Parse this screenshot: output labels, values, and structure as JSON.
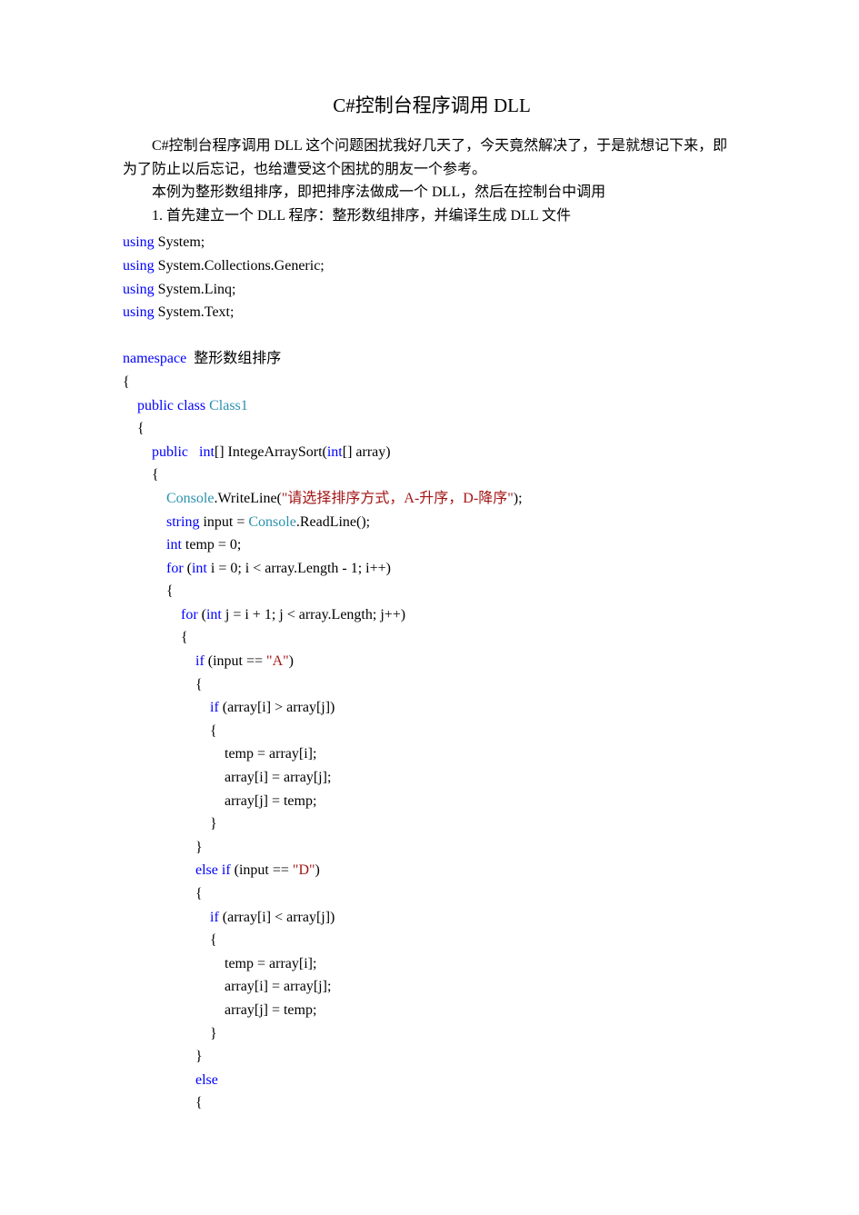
{
  "title": "C#控制台程序调用 DLL",
  "para1": "C#控制台程序调用 DLL 这个问题困扰我好几天了，今天竟然解决了，于是就想记下来，即为了防止以后忘记，也给遭受这个困扰的朋友一个参考。",
  "para2": "本例为整形数组排序，即把排序法做成一个 DLL，然后在控制台中调用",
  "para3": "1.  首先建立一个 DLL 程序：整形数组排序，并编译生成 DLL 文件",
  "code": {
    "kw_using": "using",
    "ns_system": " System;",
    "ns_generic": " System.Collections.Generic;",
    "ns_linq": " System.Linq;",
    "ns_text": " System.Text;",
    "kw_namespace": "namespace",
    "nsname": "  整形数组排序",
    "lb": "{",
    "rb": "}",
    "kw_public": "public",
    "kw_class": " class ",
    "cls": "Class1",
    "kw_int": "int",
    "methodsig1": "[] IntegeArraySort(",
    "methodsig2": "[] array)",
    "type_console": "Console",
    "writeline": ".WriteLine(",
    "str_prompt": "\"请选择排序方式，A-升序，D-降序\"",
    "kw_string": "string",
    "input_eq": " input = ",
    "readline": ".ReadLine();",
    "temp_eq": " temp = 0;",
    "kw_for": "for",
    "for_i": " i = 0; i < array.Length - 1; i++)",
    "for_j": " j = i + 1; j < array.Length; j++)",
    "kw_if": "if",
    "kw_else": "else",
    "kw_elseif": "else if",
    "cond_A": " (input == ",
    "str_A": "\"A\"",
    "cond_D": " (input == ",
    "str_D": "\"D\"",
    "cond_gt": " (array[i] > array[j])",
    "cond_lt": " (array[i] < array[j])",
    "stmt_temp": "temp = array[i];",
    "stmt_ai": "array[i] = array[j];",
    "stmt_aj": "array[j] = temp;",
    "close_paren": ")",
    "close_paren_semi": ");",
    "open_paren": " ("
  }
}
